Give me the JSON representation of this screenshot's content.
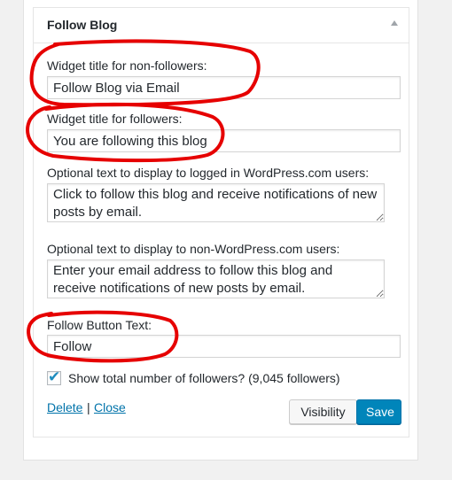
{
  "widget": {
    "title": "Follow Blog"
  },
  "fields": {
    "nonfollowers_label": "Widget title for non-followers:",
    "nonfollowers_value": "Follow Blog via Email",
    "followers_label": "Widget title for followers:",
    "followers_value": "You are following this blog",
    "loggedin_label": "Optional text to display to logged in WordPress.com users:",
    "loggedin_value": "Click to follow this blog and receive notifications of new posts by email.",
    "nonwp_label": "Optional text to display to non-WordPress.com users:",
    "nonwp_value": "Enter your email address to follow this blog and receive notifications of new posts by email.",
    "button_text_label": "Follow Button Text:",
    "button_text_value": "Follow"
  },
  "checkbox": {
    "label": "Show total number of followers? (9,045 followers)",
    "checked": true
  },
  "links": {
    "delete": "Delete",
    "separator": "|",
    "close": "Close"
  },
  "buttons": {
    "visibility": "Visibility",
    "save": "Save"
  },
  "colors": {
    "primary": "#0085ba",
    "link": "#0073aa",
    "annotation": "#e60000",
    "check": "#1e8cbe"
  },
  "icons": {
    "toggle": "collapse-arrow-icon",
    "check": "checkmark-icon"
  }
}
